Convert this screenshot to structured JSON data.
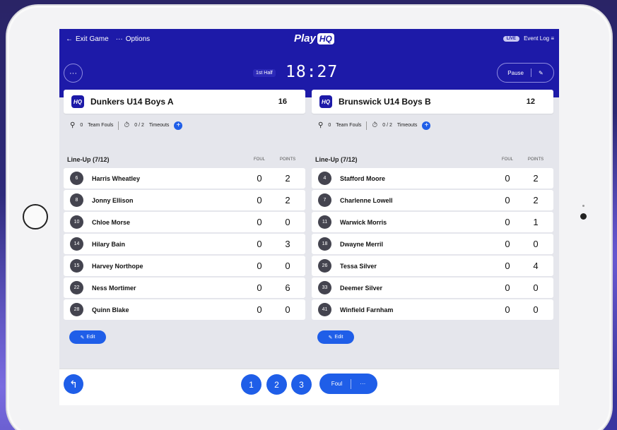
{
  "topbar": {
    "exit_label": "Exit Game",
    "options_label": "Options",
    "logo_text": "Play",
    "logo_badge": "HQ",
    "live_badge": "LIVE",
    "event_log_label": "Event Log"
  },
  "game": {
    "menu_glyph": "···",
    "half_label": "1st Half",
    "clock": "18:27",
    "pause_label": "Pause"
  },
  "teams": [
    {
      "name": "Dunkers U14 Boys A",
      "score": "16",
      "team_fouls": "0",
      "team_fouls_label": "Team Fouls",
      "timeouts": "0 / 2",
      "timeouts_label": "Timeouts",
      "lineup_title": "Line-Up (7/12)",
      "foul_header": "FOUL",
      "points_header": "POINTS",
      "edit_label": "Edit",
      "players": [
        {
          "number": "6",
          "name": "Harris Wheatley",
          "foul": "0",
          "points": "2"
        },
        {
          "number": "8",
          "name": "Jonny Ellison",
          "foul": "0",
          "points": "2"
        },
        {
          "number": "10",
          "name": "Chloe Morse",
          "foul": "0",
          "points": "0"
        },
        {
          "number": "14",
          "name": "Hilary Bain",
          "foul": "0",
          "points": "3"
        },
        {
          "number": "15",
          "name": "Harvey Northope",
          "foul": "0",
          "points": "0"
        },
        {
          "number": "22",
          "name": "Ness Mortimer",
          "foul": "0",
          "points": "6"
        },
        {
          "number": "28",
          "name": "Quinn Blake",
          "foul": "0",
          "points": "0"
        }
      ]
    },
    {
      "name": "Brunswick U14 Boys B",
      "score": "12",
      "team_fouls": "0",
      "team_fouls_label": "Team Fouls",
      "timeouts": "0 / 2",
      "timeouts_label": "Timeouts",
      "lineup_title": "Line-Up (7/12)",
      "foul_header": "FOUL",
      "points_header": "POINTS",
      "edit_label": "Edit",
      "players": [
        {
          "number": "4",
          "name": "Stafford Moore",
          "foul": "0",
          "points": "2"
        },
        {
          "number": "7",
          "name": "Charlenne Lowell",
          "foul": "0",
          "points": "2"
        },
        {
          "number": "11",
          "name": "Warwick Morris",
          "foul": "0",
          "points": "1"
        },
        {
          "number": "18",
          "name": "Dwayne Merril",
          "foul": "0",
          "points": "0"
        },
        {
          "number": "26",
          "name": "Tessa Silver",
          "foul": "0",
          "points": "4"
        },
        {
          "number": "33",
          "name": "Deemer Silver",
          "foul": "0",
          "points": "0"
        },
        {
          "number": "41",
          "name": "Winfield Farnham",
          "foul": "0",
          "points": "0"
        }
      ]
    }
  ],
  "bottom": {
    "score_buttons": [
      "1",
      "2",
      "3"
    ],
    "foul_label": "Foul",
    "more_glyph": "···"
  },
  "colors": {
    "header_bg": "#1d1aa8",
    "accent_blue": "#1f5ee8",
    "screen_bg": "#e5e6ec"
  }
}
